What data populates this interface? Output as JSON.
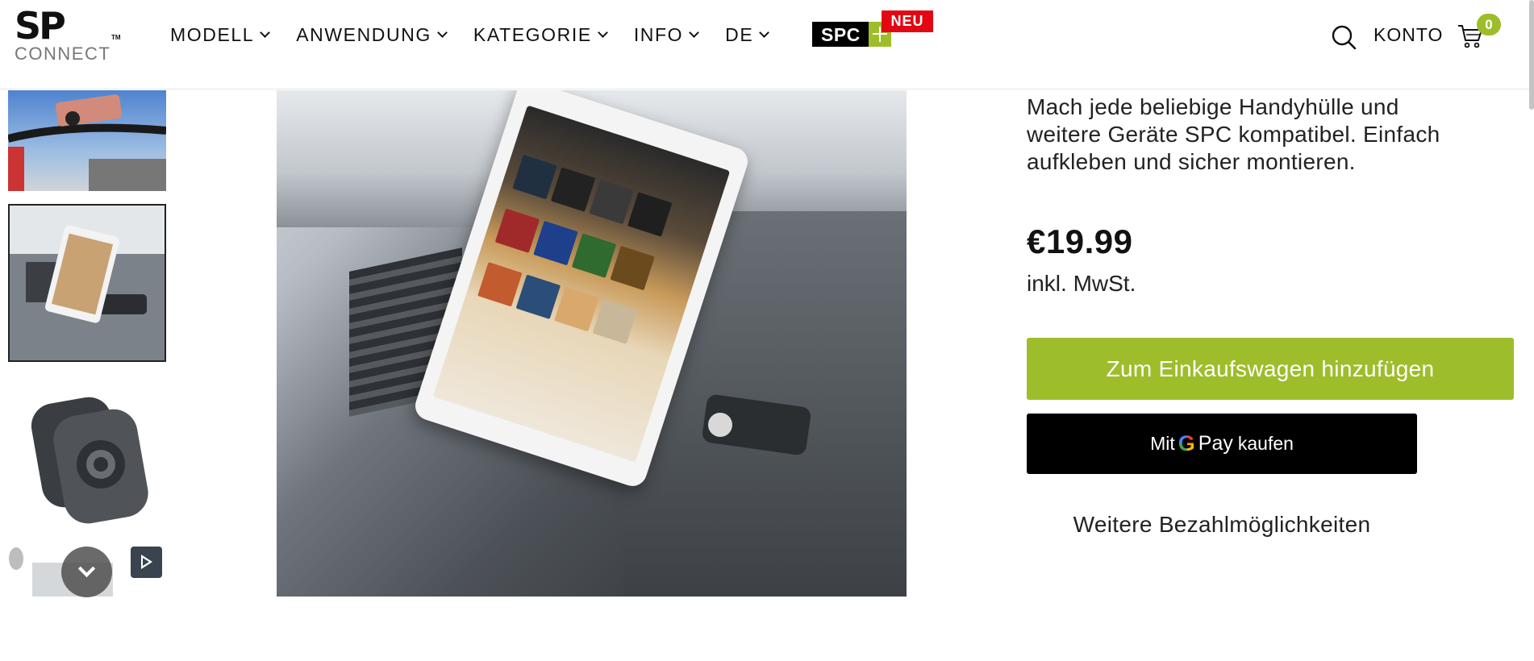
{
  "header": {
    "logo_text": "SP",
    "logo_tm": "TM",
    "logo_sub": "CONNECT",
    "nav": [
      {
        "label": "MODELL"
      },
      {
        "label": "ANWENDUNG"
      },
      {
        "label": "KATEGORIE"
      },
      {
        "label": "INFO"
      },
      {
        "label": "DE"
      }
    ],
    "spc_badge": "SPC",
    "new_badge": "NEU",
    "account_label": "KONTO",
    "cart_count": "0",
    "icons": [
      "search-icon",
      "cart-icon",
      "chevron-down-icon"
    ]
  },
  "gallery": {
    "thumbnails_icons": [
      "chevron-down-icon",
      "play-icon"
    ]
  },
  "product": {
    "description": "Mach jede beliebige Handyhülle und weitere Geräte SPC kompatibel. Einfach aufkleben und sicher montieren.",
    "price": "€19.99",
    "tax_note": "inkl. MwSt.",
    "add_to_cart": "Zum Einkaufswagen hinzufügen",
    "gpay_prefix": "Mit",
    "gpay_g": "G",
    "gpay_pay": "Pay",
    "gpay_suffix": "kaufen",
    "more_payment": "Weitere Bezahlmöglichkeiten"
  },
  "colors": {
    "brand_green": "#9dbd2b",
    "badge_red": "#e30613",
    "black": "#000000"
  }
}
